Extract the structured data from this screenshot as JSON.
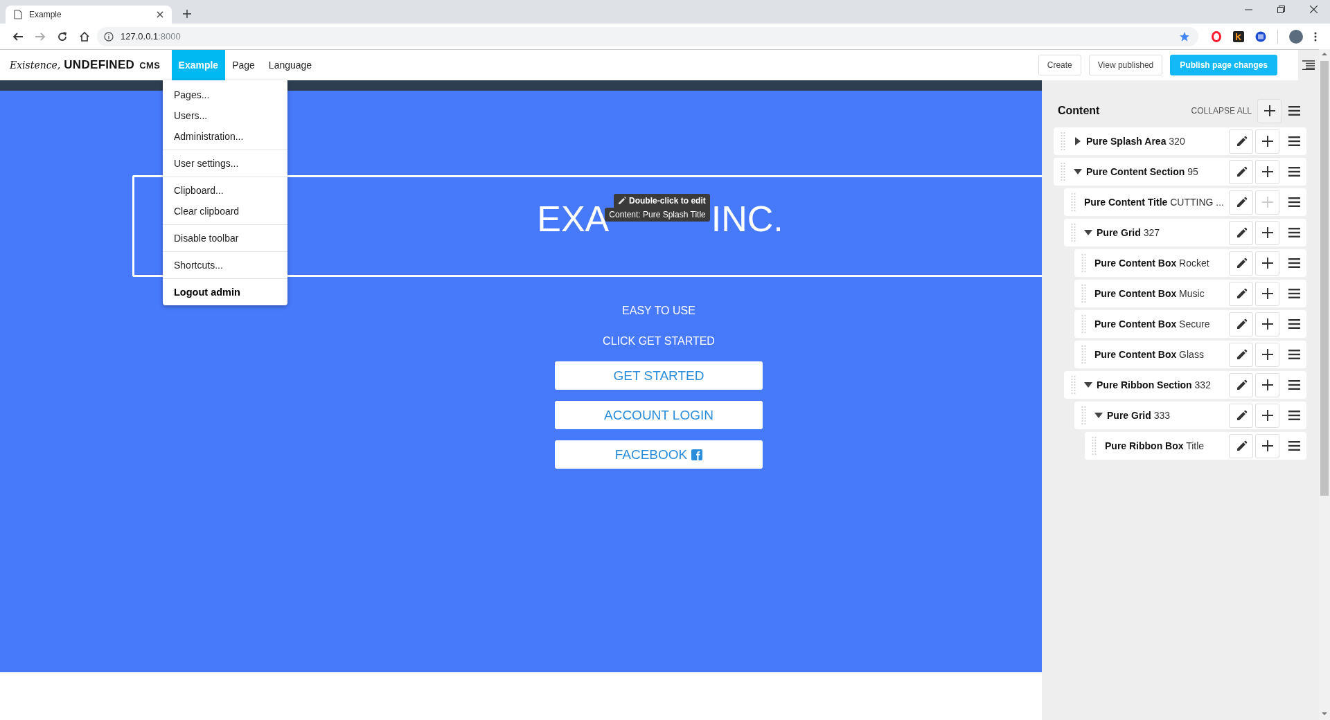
{
  "browser": {
    "tab_title": "Example",
    "address_host": "127.0.0.1",
    "address_port": ":8000"
  },
  "toolbar": {
    "logo": {
      "script": "Existence,",
      "name": "UNDEFINED",
      "suffix": "CMS"
    },
    "menu": [
      {
        "label": "Example",
        "selected": true
      },
      {
        "label": "Page",
        "selected": false
      },
      {
        "label": "Language",
        "selected": false
      }
    ],
    "actions": [
      {
        "label": "Create",
        "kind": "plain"
      },
      {
        "label": "View published",
        "kind": "plain"
      },
      {
        "label": "Publish page changes",
        "kind": "primary"
      }
    ]
  },
  "dropdown": {
    "groups": [
      {
        "items": [
          {
            "label": "Pages...",
            "kind": "normal"
          },
          {
            "label": "Users...",
            "kind": "normal"
          },
          {
            "label": "Administration...",
            "kind": "normal"
          }
        ]
      },
      {
        "items": [
          {
            "label": "User settings...",
            "kind": "normal"
          }
        ]
      },
      {
        "items": [
          {
            "label": "Clipboard...",
            "kind": "normal"
          },
          {
            "label": "Clear clipboard",
            "kind": "normal"
          }
        ]
      },
      {
        "items": [
          {
            "label": "Disable toolbar",
            "kind": "normal"
          }
        ]
      },
      {
        "items": [
          {
            "label": "Shortcuts...",
            "kind": "normal"
          }
        ]
      },
      {
        "items": [
          {
            "label": "Logout admin",
            "kind": "strong"
          }
        ]
      }
    ]
  },
  "site": {
    "title_parts": [
      "EXA",
      "INC."
    ],
    "tooltip": {
      "action": "Double-click to edit",
      "target": "Content: Pure Splash Title"
    },
    "lines": [
      "EASY TO USE",
      "CLICK GET STARTED"
    ],
    "buttons": [
      {
        "label": "GET STARTED",
        "kind": "plain"
      },
      {
        "label": "ACCOUNT LOGIN",
        "kind": "plain"
      },
      {
        "label": "FACEBOOK",
        "kind": "social"
      }
    ]
  },
  "panel": {
    "title": "Content",
    "collapse_all": "COLLAPSE ALL",
    "tree": [
      {
        "name": "Pure Splash Area",
        "detail": "320",
        "expanded": false,
        "add_disabled": false
      },
      {
        "name": "Pure Content Section",
        "detail": "95",
        "expanded": true,
        "add_disabled": false,
        "children": [
          {
            "name": "Pure Content Title",
            "detail": "CUTTING ...",
            "add_disabled": true
          },
          {
            "name": "Pure Grid",
            "detail": "327",
            "expanded": true,
            "add_disabled": false,
            "children": [
              {
                "name": "Pure Content Box",
                "detail": "Rocket",
                "add_disabled": false
              },
              {
                "name": "Pure Content Box",
                "detail": "Music",
                "add_disabled": false
              },
              {
                "name": "Pure Content Box",
                "detail": "Secure",
                "add_disabled": false
              },
              {
                "name": "Pure Content Box",
                "detail": "Glass",
                "add_disabled": false
              }
            ]
          },
          {
            "name": "Pure Ribbon Section",
            "detail": "332",
            "expanded": true,
            "add_disabled": false,
            "children": [
              {
                "name": "Pure Grid",
                "detail": "333",
                "expanded": true,
                "add_disabled": false,
                "children": [
                  {
                    "name": "Pure Ribbon Box",
                    "detail": "Title",
                    "add_disabled": false
                  }
                ]
              }
            ]
          }
        ]
      }
    ]
  }
}
